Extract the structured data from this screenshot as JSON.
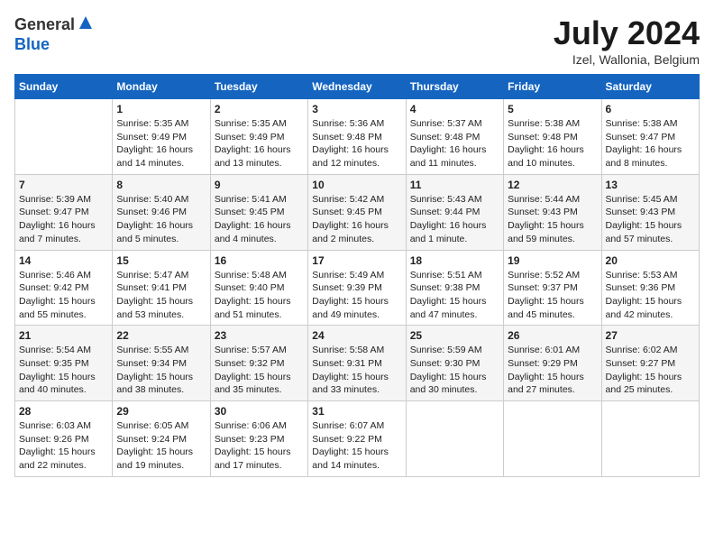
{
  "header": {
    "logo_general": "General",
    "logo_blue": "Blue",
    "title": "July 2024",
    "subtitle": "Izel, Wallonia, Belgium"
  },
  "calendar": {
    "days_of_week": [
      "Sunday",
      "Monday",
      "Tuesday",
      "Wednesday",
      "Thursday",
      "Friday",
      "Saturday"
    ],
    "weeks": [
      [
        {
          "day": "",
          "info": ""
        },
        {
          "day": "1",
          "info": "Sunrise: 5:35 AM\nSunset: 9:49 PM\nDaylight: 16 hours\nand 14 minutes."
        },
        {
          "day": "2",
          "info": "Sunrise: 5:35 AM\nSunset: 9:49 PM\nDaylight: 16 hours\nand 13 minutes."
        },
        {
          "day": "3",
          "info": "Sunrise: 5:36 AM\nSunset: 9:48 PM\nDaylight: 16 hours\nand 12 minutes."
        },
        {
          "day": "4",
          "info": "Sunrise: 5:37 AM\nSunset: 9:48 PM\nDaylight: 16 hours\nand 11 minutes."
        },
        {
          "day": "5",
          "info": "Sunrise: 5:38 AM\nSunset: 9:48 PM\nDaylight: 16 hours\nand 10 minutes."
        },
        {
          "day": "6",
          "info": "Sunrise: 5:38 AM\nSunset: 9:47 PM\nDaylight: 16 hours\nand 8 minutes."
        }
      ],
      [
        {
          "day": "7",
          "info": "Sunrise: 5:39 AM\nSunset: 9:47 PM\nDaylight: 16 hours\nand 7 minutes."
        },
        {
          "day": "8",
          "info": "Sunrise: 5:40 AM\nSunset: 9:46 PM\nDaylight: 16 hours\nand 5 minutes."
        },
        {
          "day": "9",
          "info": "Sunrise: 5:41 AM\nSunset: 9:45 PM\nDaylight: 16 hours\nand 4 minutes."
        },
        {
          "day": "10",
          "info": "Sunrise: 5:42 AM\nSunset: 9:45 PM\nDaylight: 16 hours\nand 2 minutes."
        },
        {
          "day": "11",
          "info": "Sunrise: 5:43 AM\nSunset: 9:44 PM\nDaylight: 16 hours\nand 1 minute."
        },
        {
          "day": "12",
          "info": "Sunrise: 5:44 AM\nSunset: 9:43 PM\nDaylight: 15 hours\nand 59 minutes."
        },
        {
          "day": "13",
          "info": "Sunrise: 5:45 AM\nSunset: 9:43 PM\nDaylight: 15 hours\nand 57 minutes."
        }
      ],
      [
        {
          "day": "14",
          "info": "Sunrise: 5:46 AM\nSunset: 9:42 PM\nDaylight: 15 hours\nand 55 minutes."
        },
        {
          "day": "15",
          "info": "Sunrise: 5:47 AM\nSunset: 9:41 PM\nDaylight: 15 hours\nand 53 minutes."
        },
        {
          "day": "16",
          "info": "Sunrise: 5:48 AM\nSunset: 9:40 PM\nDaylight: 15 hours\nand 51 minutes."
        },
        {
          "day": "17",
          "info": "Sunrise: 5:49 AM\nSunset: 9:39 PM\nDaylight: 15 hours\nand 49 minutes."
        },
        {
          "day": "18",
          "info": "Sunrise: 5:51 AM\nSunset: 9:38 PM\nDaylight: 15 hours\nand 47 minutes."
        },
        {
          "day": "19",
          "info": "Sunrise: 5:52 AM\nSunset: 9:37 PM\nDaylight: 15 hours\nand 45 minutes."
        },
        {
          "day": "20",
          "info": "Sunrise: 5:53 AM\nSunset: 9:36 PM\nDaylight: 15 hours\nand 42 minutes."
        }
      ],
      [
        {
          "day": "21",
          "info": "Sunrise: 5:54 AM\nSunset: 9:35 PM\nDaylight: 15 hours\nand 40 minutes."
        },
        {
          "day": "22",
          "info": "Sunrise: 5:55 AM\nSunset: 9:34 PM\nDaylight: 15 hours\nand 38 minutes."
        },
        {
          "day": "23",
          "info": "Sunrise: 5:57 AM\nSunset: 9:32 PM\nDaylight: 15 hours\nand 35 minutes."
        },
        {
          "day": "24",
          "info": "Sunrise: 5:58 AM\nSunset: 9:31 PM\nDaylight: 15 hours\nand 33 minutes."
        },
        {
          "day": "25",
          "info": "Sunrise: 5:59 AM\nSunset: 9:30 PM\nDaylight: 15 hours\nand 30 minutes."
        },
        {
          "day": "26",
          "info": "Sunrise: 6:01 AM\nSunset: 9:29 PM\nDaylight: 15 hours\nand 27 minutes."
        },
        {
          "day": "27",
          "info": "Sunrise: 6:02 AM\nSunset: 9:27 PM\nDaylight: 15 hours\nand 25 minutes."
        }
      ],
      [
        {
          "day": "28",
          "info": "Sunrise: 6:03 AM\nSunset: 9:26 PM\nDaylight: 15 hours\nand 22 minutes."
        },
        {
          "day": "29",
          "info": "Sunrise: 6:05 AM\nSunset: 9:24 PM\nDaylight: 15 hours\nand 19 minutes."
        },
        {
          "day": "30",
          "info": "Sunrise: 6:06 AM\nSunset: 9:23 PM\nDaylight: 15 hours\nand 17 minutes."
        },
        {
          "day": "31",
          "info": "Sunrise: 6:07 AM\nSunset: 9:22 PM\nDaylight: 15 hours\nand 14 minutes."
        },
        {
          "day": "",
          "info": ""
        },
        {
          "day": "",
          "info": ""
        },
        {
          "day": "",
          "info": ""
        }
      ]
    ]
  }
}
